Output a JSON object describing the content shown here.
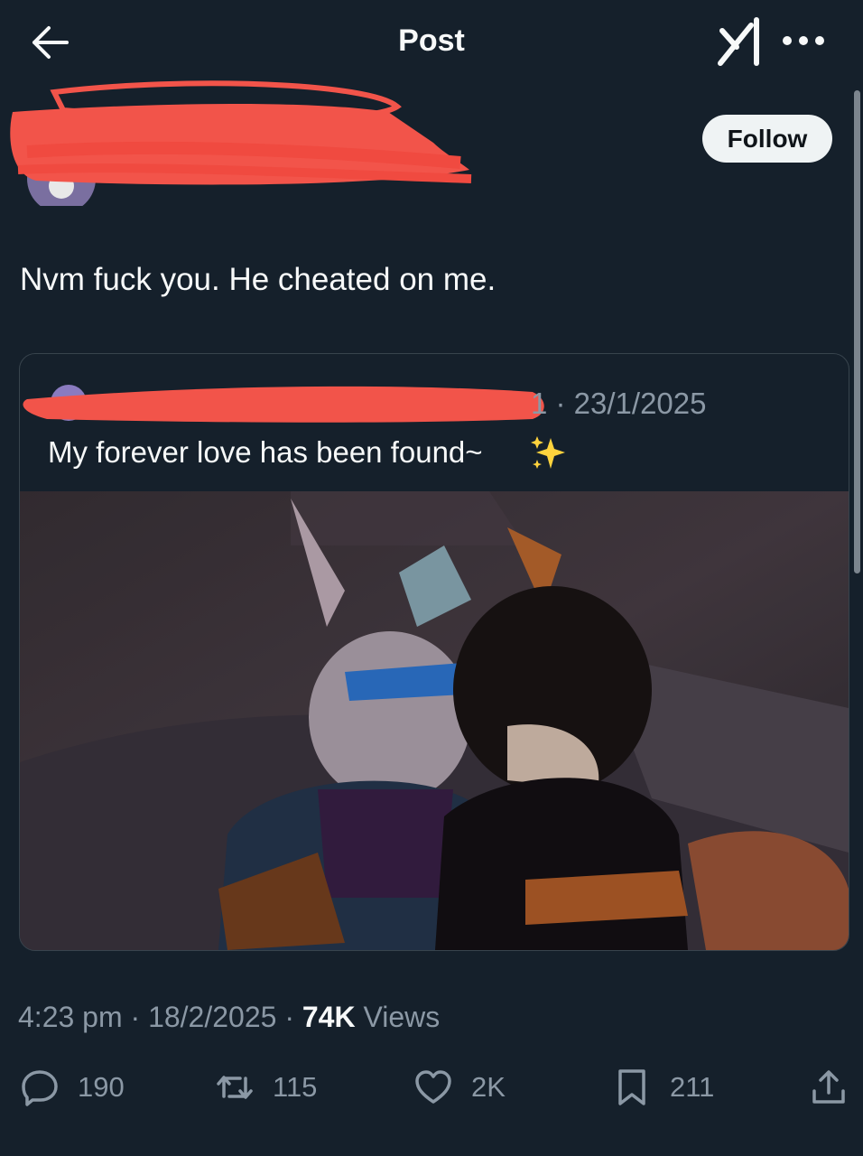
{
  "header": {
    "title": "Post"
  },
  "post": {
    "follow_label": "Follow",
    "text": "Nvm fuck you. He cheated on me."
  },
  "quoted": {
    "date": "1 · 23/1/2025",
    "text": "My forever love has been found~"
  },
  "meta": {
    "time": "4:23 pm",
    "date": "18/2/2025",
    "views_count": "74K",
    "views_label": "Views"
  },
  "actions": {
    "replies": "190",
    "reposts": "115",
    "likes": "2K",
    "bookmarks": "211"
  },
  "colors": {
    "background": "#15202b",
    "muted_text": "#8b98a5",
    "redaction": "#f2544a"
  }
}
